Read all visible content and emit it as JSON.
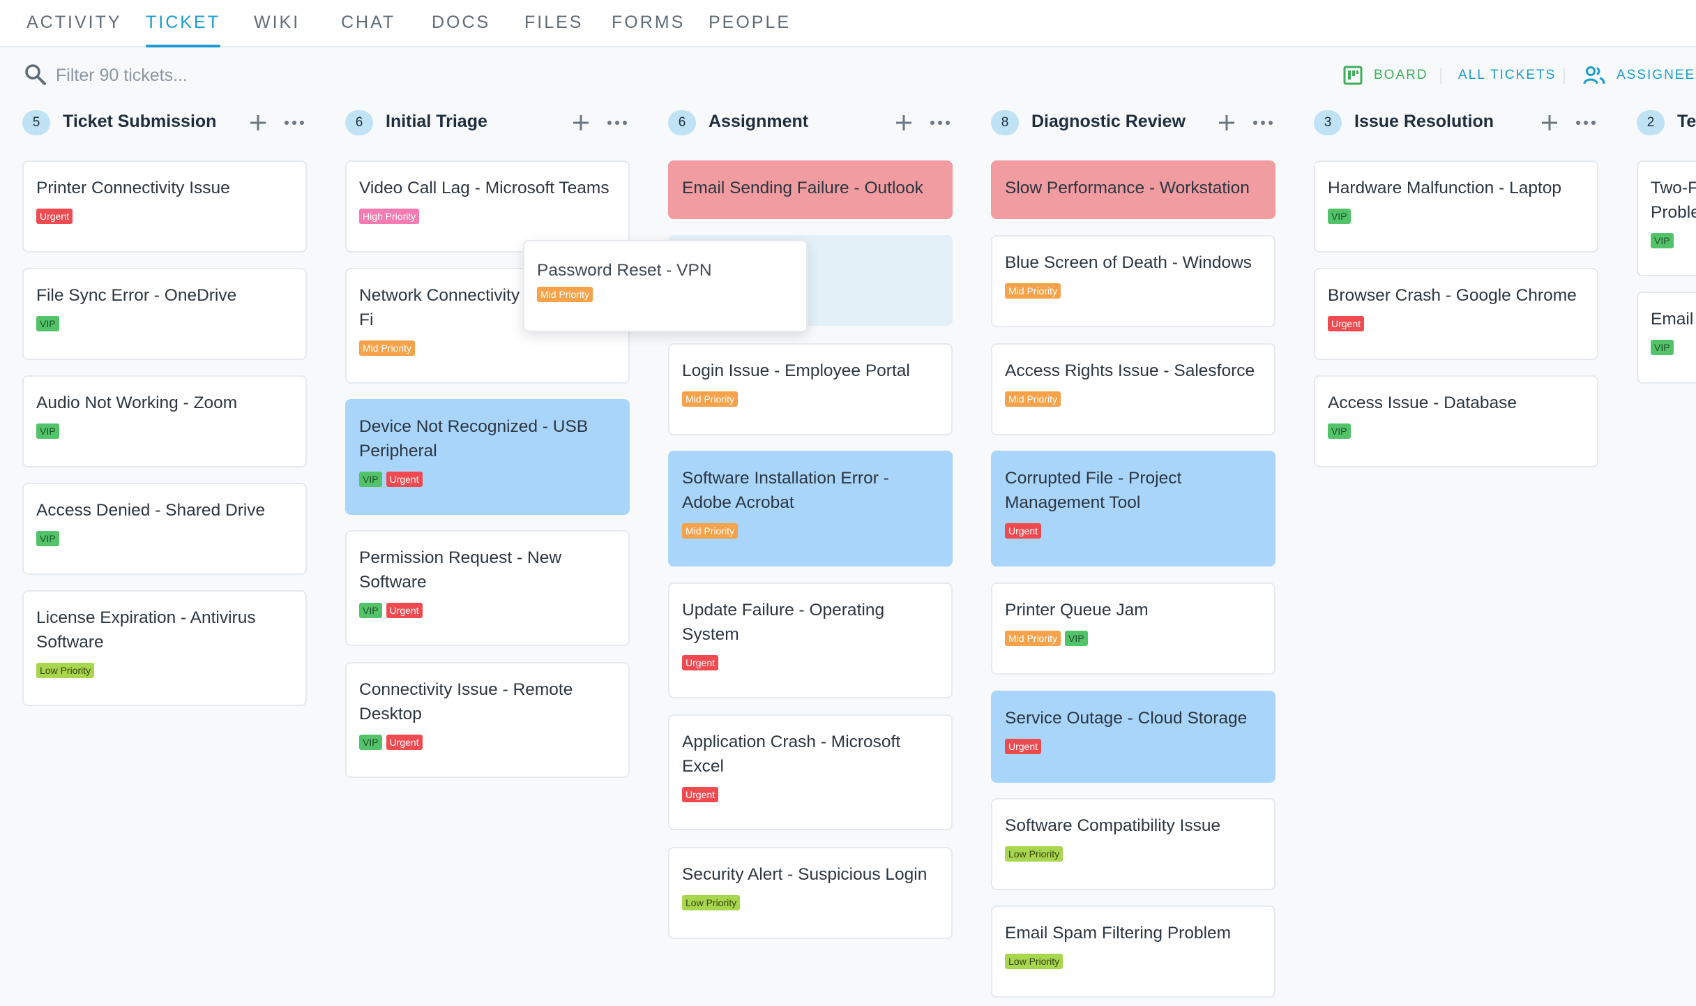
{
  "tabs": [
    {
      "label": "ACTIVITY"
    },
    {
      "label": "TICKET"
    },
    {
      "label": "WIKI"
    },
    {
      "label": "CHAT"
    },
    {
      "label": "DOCS"
    },
    {
      "label": "FILES"
    },
    {
      "label": "FORMS"
    },
    {
      "label": "PEOPLE"
    }
  ],
  "active_tab": "TICKET",
  "toolbar": {
    "filter_placeholder": "Filter 90 tickets...",
    "board_label": "BOARD",
    "all_tickets_label": "ALL TICKETS",
    "assignees_label": "ASSIGNEES"
  },
  "colors": {
    "accent": "#1a9ccf",
    "board_green": "#3fae5b",
    "red_card": "#f19ca0",
    "blue_card": "#a9d5fb"
  },
  "columns": [
    {
      "title": "Ticket Submission",
      "count": "5",
      "cards": [
        {
          "title": "Printer Connectivity Issue",
          "tags": [
            "Urgent"
          ]
        },
        {
          "title": "File Sync Error - OneDrive",
          "tags": [
            "VIP"
          ]
        },
        {
          "title": "Audio Not Working - Zoom",
          "tags": [
            "VIP"
          ]
        },
        {
          "title": "Access Denied - Shared Drive",
          "tags": [
            "VIP"
          ]
        },
        {
          "title": "License Expiration - Antivirus Software",
          "tags": [
            "Low Priority"
          ]
        }
      ]
    },
    {
      "title": "Initial Triage",
      "count": "6",
      "cards": [
        {
          "title": "Video Call Lag - Microsoft Teams",
          "tags": [
            "High Priority"
          ]
        },
        {
          "title": "Network Connectivity Issue - Wi-Fi",
          "tags": [
            "Mid Priority"
          ]
        },
        {
          "title": "Device Not Recognized - USB Peripheral",
          "tags": [
            "VIP",
            "Urgent"
          ]
        },
        {
          "title": "Permission Request - New Software",
          "tags": [
            "VIP",
            "Urgent"
          ]
        },
        {
          "title": "Connectivity Issue - Remote Desktop",
          "tags": [
            "VIP",
            "Urgent"
          ]
        }
      ]
    },
    {
      "title": "Assignment",
      "count": "6",
      "cards": [
        {
          "title": "Email Sending Failure - Outlook",
          "tags": []
        },
        {
          "title": "",
          "tags": []
        },
        {
          "title": "Login Issue - Employee Portal",
          "tags": [
            "Mid Priority"
          ]
        },
        {
          "title": "Software Installation Error - Adobe Acrobat",
          "tags": [
            "Mid Priority"
          ]
        },
        {
          "title": "Update Failure - Operating System",
          "tags": [
            "Urgent"
          ]
        },
        {
          "title": "Application Crash - Microsoft Excel",
          "tags": [
            "Urgent"
          ]
        },
        {
          "title": "Security Alert - Suspicious Login",
          "tags": [
            "Low Priority"
          ]
        }
      ]
    },
    {
      "title": "Diagnostic Review",
      "count": "8",
      "cards": [
        {
          "title": "Slow Performance - Workstation",
          "tags": []
        },
        {
          "title": "Blue Screen of Death - Windows",
          "tags": [
            "Mid Priority"
          ]
        },
        {
          "title": "Access Rights Issue - Salesforce",
          "tags": [
            "Mid Priority"
          ]
        },
        {
          "title": "Corrupted File - Project Management Tool",
          "tags": [
            "Urgent"
          ]
        },
        {
          "title": "Printer Queue Jam",
          "tags": [
            "Mid Priority",
            "VIP"
          ]
        },
        {
          "title": "Service Outage - Cloud Storage",
          "tags": [
            "Urgent"
          ]
        },
        {
          "title": "Software Compatibility Issue",
          "tags": [
            "Low Priority"
          ]
        },
        {
          "title": "Email Spam Filtering Problem",
          "tags": [
            "Low Priority"
          ]
        }
      ]
    },
    {
      "title": "Issue Resolution",
      "count": "3",
      "cards": [
        {
          "title": "Hardware Malfunction - Laptop",
          "tags": [
            "VIP"
          ]
        },
        {
          "title": "Browser Crash - Google Chrome",
          "tags": [
            "Urgent"
          ]
        },
        {
          "title": "Access Issue - Database",
          "tags": [
            "VIP"
          ]
        }
      ]
    },
    {
      "title": "Te",
      "count": "2",
      "cards": [
        {
          "title": "Two-F Proble",
          "tags": [
            "VIP"
          ]
        },
        {
          "title": "Email",
          "tags": [
            "VIP"
          ]
        }
      ]
    }
  ],
  "dragging_card": {
    "title": "Password Reset - VPN",
    "tags": [
      "Mid Priority"
    ]
  }
}
